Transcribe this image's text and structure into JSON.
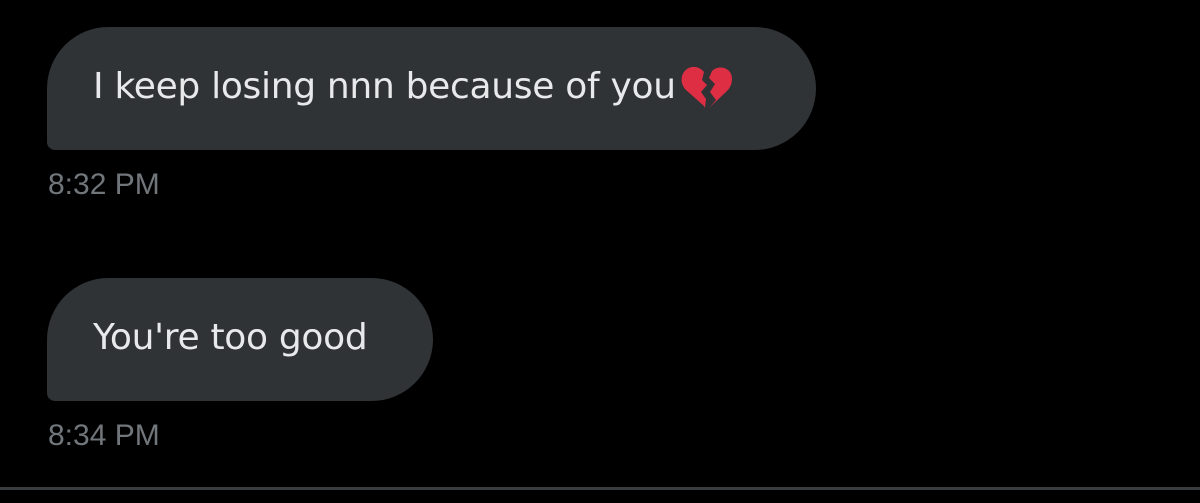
{
  "messages": [
    {
      "text": "I keep losing nnn because of you",
      "emoji": "broken-heart-icon",
      "timestamp": "8:32 PM"
    },
    {
      "text": "You're too good",
      "timestamp": "8:34 PM"
    }
  ],
  "colors": {
    "background": "#000000",
    "bubble": "#2f3336",
    "message_text": "#e7e9ea",
    "timestamp_text": "#71767b",
    "emoji": "#dd2e44"
  }
}
